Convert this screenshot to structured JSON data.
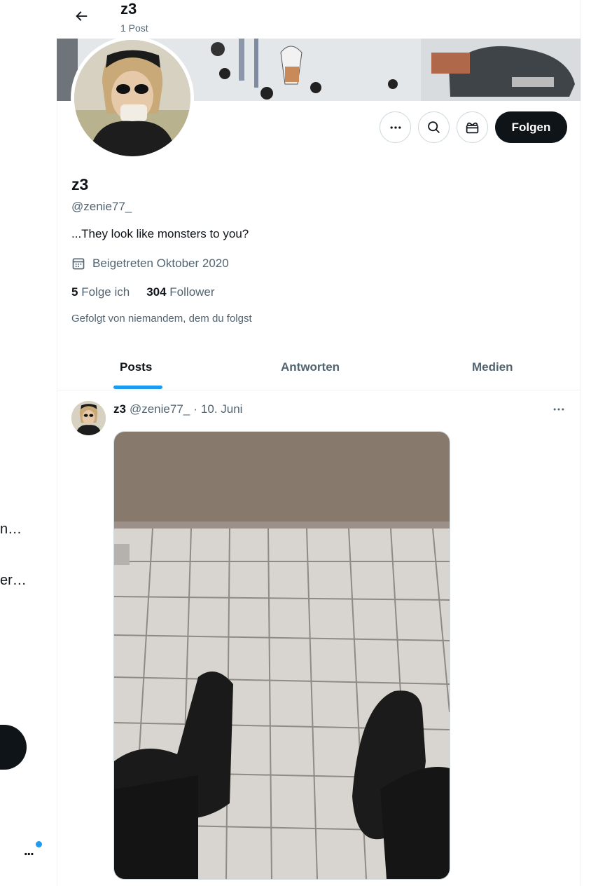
{
  "sidebar": {
    "trunc_item_1": "n…",
    "trunc_item_2": "er…",
    "more_label": "..."
  },
  "header": {
    "title": "z3",
    "post_count": "1 Post",
    "back_icon": "arrow-left-icon"
  },
  "profile": {
    "name": "z3",
    "handle": "@zenie77_",
    "bio": "...They look like monsters to you?",
    "joined": "Beigetreten Oktober 2020",
    "joined_icon": "calendar-icon",
    "following_count": "5",
    "following_label": "Folge ich",
    "followers_count": "304",
    "followers_label": "Follower",
    "followed_by": "Gefolgt von niemandem, dem du folgst",
    "follow_label": "Folgen",
    "actions": [
      "more-icon",
      "search-icon",
      "gift-icon"
    ]
  },
  "tabs": [
    {
      "label": "Posts",
      "active": true
    },
    {
      "label": "Antworten",
      "active": false
    },
    {
      "label": "Medien",
      "active": false
    }
  ],
  "tweet": {
    "name": "z3",
    "handle": "@zenie77_",
    "separator": "·",
    "date": "10. Juni"
  },
  "colors": {
    "accent": "#1d9bf0",
    "text": "#0f1419",
    "muted": "#536471",
    "follow_bg": "#0f1419"
  }
}
